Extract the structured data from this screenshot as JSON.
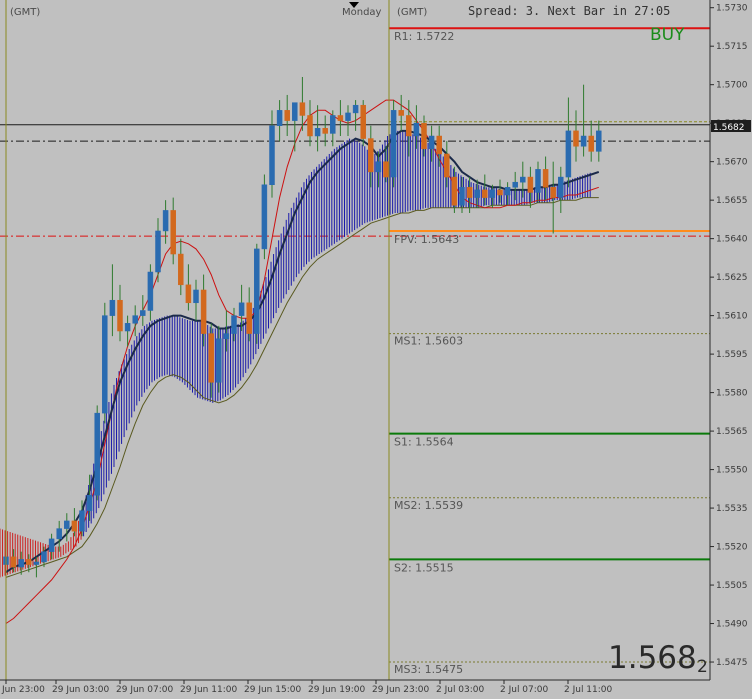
{
  "header": {
    "gmt_left": "(GMT)",
    "day_label": "Monday",
    "gmt_right": "(GMT)",
    "spread_info": "Spread: 3.  Next Bar in 27:05"
  },
  "signal": {
    "label": "BUY",
    "color": "#1a8c1a"
  },
  "big_price": {
    "main": "1.568",
    "sub": "2"
  },
  "current_price": {
    "value": "1.5682"
  },
  "colors": {
    "background": "#c0c0c0",
    "bull_candle": "#2a6bb0",
    "bear_candle": "#d2691e",
    "cloud_bull": "#1a1aaa",
    "cloud_bear": "#cc2020",
    "ma_dark": "#1b2a4a",
    "ma_red": "#cc1111",
    "ma_olive": "#5a5a20",
    "pivot_green": "#0a7a0a",
    "pivot_red": "#dd1111",
    "fpv_orange": "#ff8c1a"
  },
  "levels": [
    {
      "name": "R1",
      "label": "R1:  1.5722",
      "price": 1.5722,
      "style": "solid-red"
    },
    {
      "name": "FPV",
      "label": "FPV: 1.5643",
      "price": 1.5643,
      "style": "solid-orange"
    },
    {
      "name": "MS1",
      "label": "MS1: 1.5603",
      "price": 1.5603,
      "style": "dotted"
    },
    {
      "name": "S1",
      "label": "S1:  1.5564",
      "price": 1.5564,
      "style": "solid-green"
    },
    {
      "name": "MS2",
      "label": "MS2: 1.5539",
      "price": 1.5539,
      "style": "dotted"
    },
    {
      "name": "S2",
      "label": "S2:  1.5515",
      "price": 1.5515,
      "style": "solid-green"
    },
    {
      "name": "MS3",
      "label": "MS3: 1.5475",
      "price": 1.5475,
      "style": "dotted"
    }
  ],
  "extra_lines": {
    "dashdot_black_price": 1.5678,
    "solid_black_price": 1.5684,
    "dashdot_red_price": 1.5641,
    "dashed_olive_price": 1.5684
  },
  "y_ticks": [
    "1.5730",
    "1.5715",
    "1.5700",
    "1.5685",
    "1.5670",
    "1.5655",
    "1.5640",
    "1.5625",
    "1.5610",
    "1.5595",
    "1.5580",
    "1.5565",
    "1.5550",
    "1.5535",
    "1.5520",
    "1.5505",
    "1.5490",
    "1.5475"
  ],
  "x_ticks": [
    "Jun 23:00",
    "29 Jun 03:00",
    "29 Jun 07:00",
    "29 Jun 11:00",
    "29 Jun 15:00",
    "29 Jun 19:00",
    "29 Jun 23:00",
    "2 Jul 03:00",
    "2 Jul 07:00",
    "2 Jul 11:00"
  ],
  "chart_data": {
    "type": "candlestick",
    "price_range": [
      1.5468,
      1.5733
    ],
    "candles": [
      [
        1.5513,
        1.552,
        1.5508,
        1.5516
      ],
      [
        1.5516,
        1.5519,
        1.551,
        1.5512
      ],
      [
        1.5512,
        1.5518,
        1.5509,
        1.5515
      ],
      [
        1.5515,
        1.5517,
        1.551,
        1.5513
      ],
      [
        1.5513,
        1.5516,
        1.5508,
        1.5514
      ],
      [
        1.5514,
        1.552,
        1.5512,
        1.5518
      ],
      [
        1.5518,
        1.5525,
        1.5515,
        1.5523
      ],
      [
        1.5523,
        1.553,
        1.5518,
        1.5527
      ],
      [
        1.5527,
        1.5533,
        1.5522,
        1.553
      ],
      [
        1.553,
        1.5535,
        1.5524,
        1.5526
      ],
      [
        1.5526,
        1.5538,
        1.5524,
        1.5534
      ],
      [
        1.5534,
        1.5548,
        1.553,
        1.554
      ],
      [
        1.554,
        1.5575,
        1.5538,
        1.5572
      ],
      [
        1.5572,
        1.5615,
        1.5568,
        1.561
      ],
      [
        1.561,
        1.563,
        1.5602,
        1.5616
      ],
      [
        1.5616,
        1.5622,
        1.56,
        1.5604
      ],
      [
        1.5604,
        1.561,
        1.5598,
        1.5607
      ],
      [
        1.5607,
        1.5614,
        1.5602,
        1.561
      ],
      [
        1.561,
        1.5618,
        1.5606,
        1.5612
      ],
      [
        1.5612,
        1.563,
        1.5608,
        1.5627
      ],
      [
        1.5627,
        1.5648,
        1.5623,
        1.5643
      ],
      [
        1.5643,
        1.5655,
        1.5638,
        1.5651
      ],
      [
        1.5651,
        1.5656,
        1.563,
        1.5634
      ],
      [
        1.5634,
        1.564,
        1.5618,
        1.5622
      ],
      [
        1.5622,
        1.563,
        1.5612,
        1.5615
      ],
      [
        1.5615,
        1.5624,
        1.5608,
        1.562
      ],
      [
        1.562,
        1.5626,
        1.5598,
        1.5603
      ],
      [
        1.5603,
        1.5607,
        1.5578,
        1.5584
      ],
      [
        1.5584,
        1.5606,
        1.558,
        1.5601
      ],
      [
        1.5601,
        1.5612,
        1.5596,
        1.5603
      ],
      [
        1.5603,
        1.5613,
        1.56,
        1.561
      ],
      [
        1.561,
        1.5622,
        1.5604,
        1.5615
      ],
      [
        1.5615,
        1.5621,
        1.56,
        1.5603
      ],
      [
        1.5603,
        1.5638,
        1.5599,
        1.5636
      ],
      [
        1.5636,
        1.5665,
        1.5632,
        1.5661
      ],
      [
        1.5661,
        1.569,
        1.5656,
        1.5684
      ],
      [
        1.5684,
        1.5694,
        1.5678,
        1.569
      ],
      [
        1.569,
        1.5696,
        1.568,
        1.5686
      ],
      [
        1.5686,
        1.5692,
        1.5674,
        1.5693
      ],
      [
        1.5693,
        1.5703,
        1.5682,
        1.5688
      ],
      [
        1.5688,
        1.5694,
        1.5676,
        1.568
      ],
      [
        1.568,
        1.5692,
        1.5674,
        1.5683
      ],
      [
        1.5683,
        1.5688,
        1.5676,
        1.5681
      ],
      [
        1.5681,
        1.569,
        1.5676,
        1.5688
      ],
      [
        1.5688,
        1.5694,
        1.568,
        1.5686
      ],
      [
        1.5686,
        1.5692,
        1.568,
        1.5689
      ],
      [
        1.5689,
        1.5694,
        1.5682,
        1.5692
      ],
      [
        1.5692,
        1.5694,
        1.5676,
        1.5679
      ],
      [
        1.5679,
        1.5684,
        1.566,
        1.5666
      ],
      [
        1.5666,
        1.5674,
        1.566,
        1.567
      ],
      [
        1.567,
        1.5676,
        1.5662,
        1.5664
      ],
      [
        1.5664,
        1.5694,
        1.566,
        1.569
      ],
      [
        1.569,
        1.5696,
        1.5682,
        1.5688
      ],
      [
        1.5688,
        1.5694,
        1.5672,
        1.568
      ],
      [
        1.568,
        1.5692,
        1.5675,
        1.5685
      ],
      [
        1.5685,
        1.5688,
        1.5672,
        1.5675
      ],
      [
        1.5675,
        1.5684,
        1.567,
        1.568
      ],
      [
        1.568,
        1.5684,
        1.5668,
        1.5673
      ],
      [
        1.5673,
        1.5678,
        1.566,
        1.5664
      ],
      [
        1.5664,
        1.5668,
        1.565,
        1.5653
      ],
      [
        1.5653,
        1.5664,
        1.565,
        1.566
      ],
      [
        1.566,
        1.5664,
        1.565,
        1.5656
      ],
      [
        1.5656,
        1.5663,
        1.5652,
        1.5659
      ],
      [
        1.5659,
        1.5665,
        1.5653,
        1.5656
      ],
      [
        1.5656,
        1.5661,
        1.5652,
        1.5659
      ],
      [
        1.5659,
        1.5663,
        1.5654,
        1.5657
      ],
      [
        1.5657,
        1.5662,
        1.5653,
        1.566
      ],
      [
        1.566,
        1.5666,
        1.5655,
        1.5662
      ],
      [
        1.5662,
        1.567,
        1.5656,
        1.5664
      ],
      [
        1.5664,
        1.5668,
        1.5652,
        1.5658
      ],
      [
        1.5658,
        1.567,
        1.5654,
        1.5667
      ],
      [
        1.5667,
        1.5672,
        1.5655,
        1.566
      ],
      [
        1.566,
        1.567,
        1.5642,
        1.5656
      ],
      [
        1.5656,
        1.5668,
        1.565,
        1.5664
      ],
      [
        1.5664,
        1.5695,
        1.566,
        1.5682
      ],
      [
        1.5682,
        1.569,
        1.567,
        1.5676
      ],
      [
        1.5676,
        1.57,
        1.5672,
        1.568
      ],
      [
        1.568,
        1.5686,
        1.567,
        1.5674
      ],
      [
        1.5674,
        1.5686,
        1.567,
        1.5682
      ]
    ],
    "ma_dark": [
      1.551,
      1.5512,
      1.5513,
      1.5514,
      1.5516,
      1.5518,
      1.552,
      1.5522,
      1.5525,
      1.5529,
      1.5534,
      1.5542,
      1.5552,
      1.5563,
      1.5574,
      1.5584,
      1.5591,
      1.5597,
      1.5602,
      1.5606,
      1.5608,
      1.5609,
      1.561,
      1.561,
      1.5609,
      1.5608,
      1.5608,
      1.5607,
      1.5605,
      1.5605,
      1.5606,
      1.5606,
      1.5608,
      1.5611,
      1.5617,
      1.5625,
      1.5634,
      1.5642,
      1.565,
      1.5656,
      1.5662,
      1.5666,
      1.5669,
      1.5672,
      1.5675,
      1.5677,
      1.5679,
      1.5678,
      1.5676,
      1.5672,
      1.5675,
      1.568,
      1.5682,
      1.5682,
      1.5681,
      1.568,
      1.5678,
      1.5676,
      1.5673,
      1.567,
      1.5666,
      1.5664,
      1.5662,
      1.5661,
      1.566,
      1.566,
      1.5659,
      1.5659,
      1.5659,
      1.5659,
      1.566,
      1.566,
      1.5661,
      1.5661,
      1.5662,
      1.5663,
      1.5664,
      1.5665,
      1.5666
    ],
    "ma_red": [
      1.549,
      1.5492,
      1.5495,
      1.5498,
      1.5501,
      1.5504,
      1.5507,
      1.5511,
      1.5515,
      1.552,
      1.5527,
      1.5536,
      1.5546,
      1.556,
      1.5574,
      1.5588,
      1.5598,
      1.5606,
      1.5612,
      1.5618,
      1.5626,
      1.5634,
      1.5638,
      1.5639,
      1.5638,
      1.5636,
      1.5632,
      1.5626,
      1.5618,
      1.5612,
      1.561,
      1.5609,
      1.5609,
      1.5612,
      1.5624,
      1.564,
      1.5656,
      1.5668,
      1.5677,
      1.5684,
      1.5688,
      1.569,
      1.569,
      1.5688,
      1.5686,
      1.5685,
      1.5686,
      1.5688,
      1.569,
      1.5692,
      1.5694,
      1.5694,
      1.5692,
      1.569,
      1.5686,
      1.5682,
      1.5677,
      1.5671,
      1.5666,
      1.5661,
      1.5656,
      1.5654,
      1.5653,
      1.5652,
      1.5652,
      1.5652,
      1.5653,
      1.5653,
      1.5654,
      1.5654,
      1.5655,
      1.5655,
      1.5656,
      1.5656,
      1.5657,
      1.5657,
      1.5658,
      1.5659,
      1.566
    ],
    "cloud_upper": [
      1.5527,
      1.5526,
      1.5525,
      1.5524,
      1.5523,
      1.5522,
      1.5521,
      1.552,
      1.552,
      1.5522,
      1.5527,
      1.5536,
      1.5548,
      1.5561,
      1.5573,
      1.5583,
      1.5591,
      1.5597,
      1.5602,
      1.5606,
      1.5608,
      1.5609,
      1.561,
      1.561,
      1.5609,
      1.5608,
      1.5608,
      1.5607,
      1.5605,
      1.5605,
      1.5606,
      1.5606,
      1.5608,
      1.5611,
      1.5617,
      1.5625,
      1.5634,
      1.5642,
      1.565,
      1.5656,
      1.5662,
      1.5666,
      1.5669,
      1.5672,
      1.5675,
      1.5677,
      1.5679,
      1.5678,
      1.5676,
      1.5672,
      1.5675,
      1.568,
      1.5682,
      1.5682,
      1.5681,
      1.568,
      1.5678,
      1.5676,
      1.5673,
      1.567,
      1.5666,
      1.5664,
      1.5662,
      1.5661,
      1.566,
      1.566,
      1.5659,
      1.5659,
      1.5659,
      1.5659,
      1.566,
      1.566,
      1.5661,
      1.5661,
      1.5662,
      1.5663,
      1.5664,
      1.5665,
      1.5666
    ],
    "cloud_lower": [
      1.5508,
      1.5509,
      1.551,
      1.5511,
      1.5512,
      1.5513,
      1.5514,
      1.5515,
      1.5516,
      1.5518,
      1.552,
      1.5524,
      1.5529,
      1.5535,
      1.5543,
      1.5551,
      1.556,
      1.5568,
      1.5575,
      1.558,
      1.5584,
      1.5586,
      1.5587,
      1.5586,
      1.5584,
      1.5581,
      1.5578,
      1.5577,
      1.5576,
      1.5577,
      1.5579,
      1.5582,
      1.5586,
      1.5591,
      1.5597,
      1.5603,
      1.5609,
      1.5615,
      1.562,
      1.5625,
      1.5629,
      1.5632,
      1.5634,
      1.5636,
      1.5638,
      1.564,
      1.5642,
      1.5644,
      1.5646,
      1.5647,
      1.5648,
      1.5649,
      1.565,
      1.565,
      1.5651,
      1.5651,
      1.5652,
      1.5652,
      1.5652,
      1.5652,
      1.5652,
      1.5652,
      1.5652,
      1.5652,
      1.5653,
      1.5653,
      1.5653,
      1.5653,
      1.5653,
      1.5653,
      1.5654,
      1.5654,
      1.5654,
      1.5655,
      1.5655,
      1.5655,
      1.5656,
      1.5656,
      1.5656
    ]
  }
}
